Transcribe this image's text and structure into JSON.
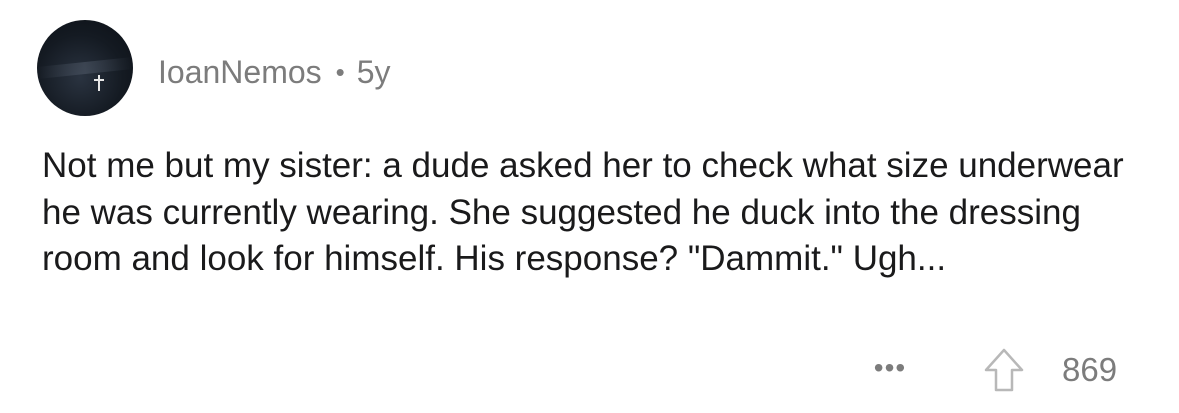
{
  "comment": {
    "author": "IoanNemos",
    "separator": "•",
    "age": "5y",
    "body": "Not me but my sister: a dude asked her to check what size underwear he was currently wearing. She suggested he duck into the dressing room and look for himself. His response? \"Dammit.\" Ugh...",
    "actions": {
      "more_label": "•••",
      "upvote_icon": "upvote-arrow-icon",
      "score": "869"
    }
  },
  "colors": {
    "text": "#1a1a1b",
    "muted": "#7c7c7c",
    "background": "#ffffff"
  }
}
